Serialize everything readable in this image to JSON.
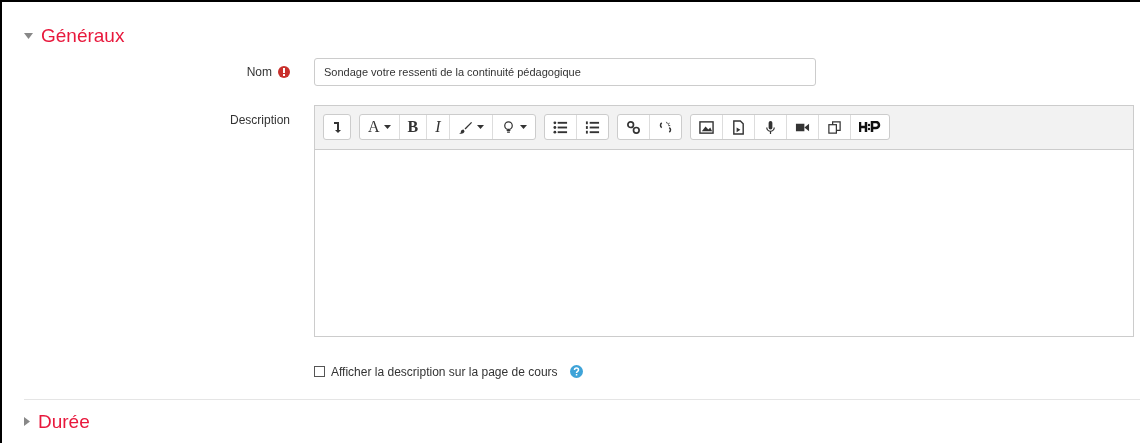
{
  "sections": [
    {
      "title": "Généraux",
      "expanded": true,
      "fields": [
        {
          "kind": "text",
          "label": "Nom",
          "required": true,
          "value": "Sondage votre ressenti de la continuité pédagogique"
        },
        {
          "kind": "editor",
          "label": "Description",
          "toolbar": [
            [
              {
                "kind": "icon",
                "menu": false
              }
            ],
            [
              {
                "kind": "text",
                "label": "A",
                "menu": true
              },
              {
                "kind": "text",
                "label": "B",
                "menu": false
              },
              {
                "kind": "text",
                "label": "I",
                "menu": false
              },
              {
                "kind": "icon",
                "menu": true
              },
              {
                "kind": "icon",
                "menu": true
              }
            ],
            [
              {
                "kind": "icon",
                "menu": false
              },
              {
                "kind": "icon",
                "menu": false
              }
            ],
            [
              {
                "kind": "icon",
                "menu": false
              },
              {
                "kind": "icon",
                "menu": false
              }
            ],
            [
              {
                "kind": "icon",
                "menu": false
              },
              {
                "kind": "icon",
                "menu": false
              },
              {
                "kind": "icon",
                "menu": false
              },
              {
                "kind": "icon",
                "menu": false
              },
              {
                "kind": "icon",
                "menu": false
              },
              {
                "kind": "icon",
                "menu": false
              }
            ]
          ]
        },
        {
          "kind": "checkbox",
          "label": "Afficher la description sur la page de cours",
          "checked": false,
          "help": true
        }
      ]
    },
    {
      "title": "Durée",
      "expanded": false
    }
  ]
}
